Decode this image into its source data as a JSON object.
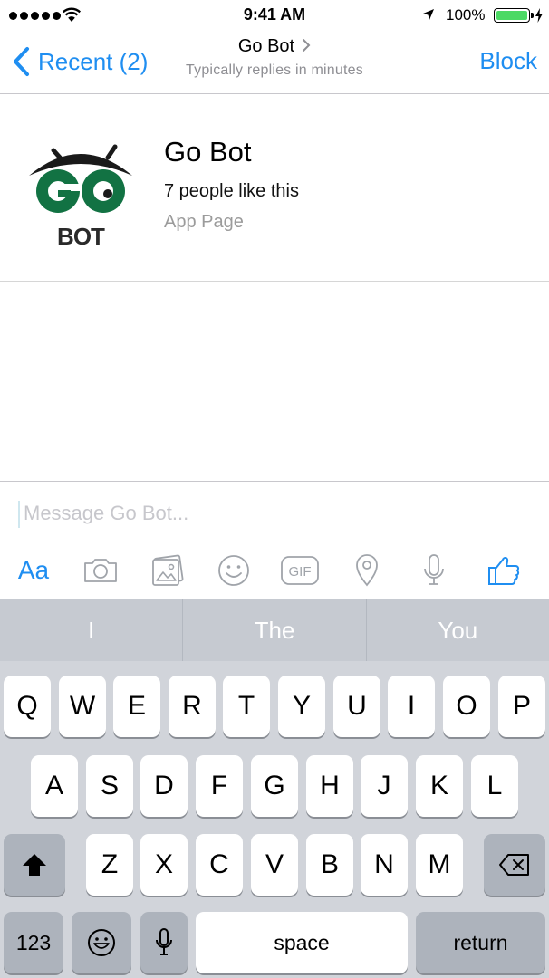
{
  "status_bar": {
    "time": "9:41 AM",
    "battery_percent": "100%",
    "signal_bars": 5,
    "battery_color": "#4cd964"
  },
  "nav": {
    "back_label": "Recent (2)",
    "title": "Go Bot",
    "subtitle": "Typically replies in minutes",
    "block_label": "Block",
    "accent_color": "#1f8ef1"
  },
  "profile": {
    "logo_text_top": "GO",
    "logo_text_bottom": "BOT",
    "name": "Go Bot",
    "likes": "7 people like this",
    "type": "App Page"
  },
  "composer": {
    "placeholder": "Message Go Bot...",
    "text_button_label": "Aa",
    "toolbar_icons": [
      "text-format-icon",
      "camera-icon",
      "photo-icon",
      "emoji-icon",
      "gif-icon",
      "location-icon",
      "microphone-icon",
      "thumbs-up-icon"
    ],
    "gif_label": "GIF"
  },
  "keyboard": {
    "suggestions": [
      "I",
      "The",
      "You"
    ],
    "row1": [
      "Q",
      "W",
      "E",
      "R",
      "T",
      "Y",
      "U",
      "I",
      "O",
      "P"
    ],
    "row2": [
      "A",
      "S",
      "D",
      "F",
      "G",
      "H",
      "J",
      "K",
      "L"
    ],
    "row3": [
      "Z",
      "X",
      "C",
      "V",
      "B",
      "N",
      "M"
    ],
    "numbers_label": "123",
    "space_label": "space",
    "return_label": "return"
  }
}
